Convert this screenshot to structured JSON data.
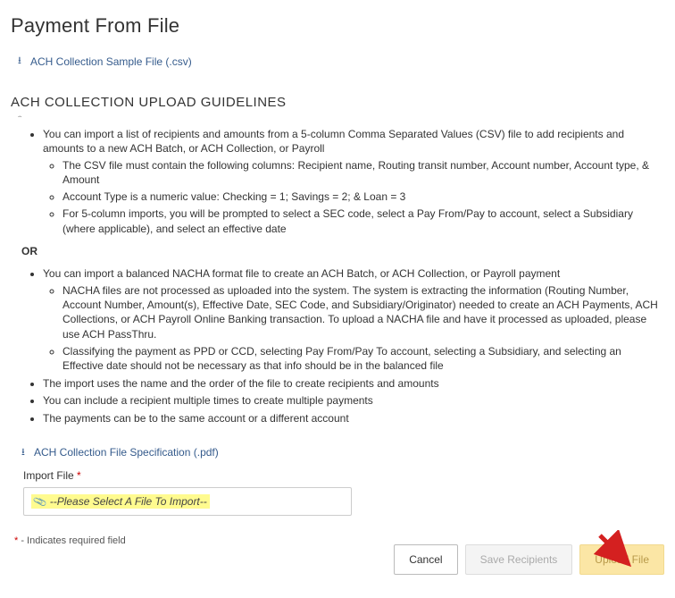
{
  "page_title": "Payment From File",
  "sample_link_label": "ACH Collection Sample File (.csv)",
  "guidelines_heading": "ACH COLLECTION UPLOAD GUIDELINES",
  "guidelines_part1": {
    "b1": "You can import a list of recipients and amounts from a 5-column Comma Separated Values (CSV) file to add recipients and amounts to a new ACH Batch, or ACH Collection, or Payroll",
    "b1_sub1": "The CSV file must contain the following columns: Recipient name, Routing transit number, Account number, Account type, & Amount",
    "b1_sub2": "Account Type is a numeric value: Checking = 1; Savings = 2; & Loan = 3",
    "b1_sub3": "For 5-column imports, you will be prompted to select a SEC code, select a Pay From/Pay to account, select a Subsidiary (where applicable), and select an effective date"
  },
  "or_separator": "OR",
  "guidelines_part2": {
    "b1": "You can import a balanced NACHA format file to create an ACH Batch, or ACH Collection, or Payroll payment",
    "b1_sub1": "NACHA files are not processed as uploaded into the system. The system is extracting the information (Routing Number, Account Number, Amount(s), Effective Date, SEC Code, and Subsidiary/Originator) needed to create an ACH Payments, ACH Collections, or ACH Payroll Online Banking transaction. To upload a NACHA file and have it processed as uploaded, please use ACH PassThru.",
    "b1_sub2": "Classifying the payment as PPD or CCD, selecting Pay From/Pay To account, selecting a Subsidiary, and selecting an Effective date should not be necessary as that info should be in the balanced file",
    "b2": "The import uses the name and the order of the file to create recipients and amounts",
    "b3": "You can include a recipient multiple times to create multiple payments",
    "b4": "The payments can be to the same account or a different account"
  },
  "spec_link_label": "ACH Collection File Specification (.pdf)",
  "import_label": "Import File",
  "file_placeholder": "--Please Select A File To Import--",
  "required_footnote": " - Indicates required field",
  "buttons": {
    "cancel": "Cancel",
    "save": "Save Recipients",
    "upload": "Upload File"
  }
}
